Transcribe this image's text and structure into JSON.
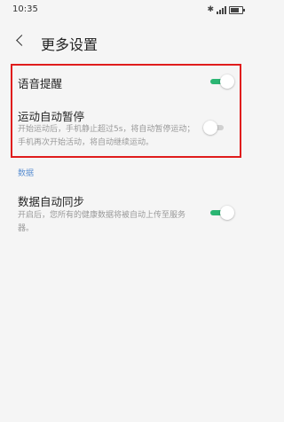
{
  "status_bar": {
    "time": "10:35",
    "bluetooth_symbol": "✱",
    "battery_icon": "battery-icon",
    "signal_icon": "signal-icon"
  },
  "header": {
    "title": "更多设置",
    "back_icon": "back-arrow-icon"
  },
  "settings": {
    "voice_reminder": {
      "label": "语音提醒",
      "enabled": true
    },
    "auto_pause": {
      "label": "运动自动暂停",
      "description_line1": "开始运动后，手机静止超过5s，将自动暂停运动；",
      "description_line2": "手机再次开始活动，将自动继续运动。",
      "enabled": false
    },
    "data_section": {
      "header": "数据"
    },
    "auto_sync": {
      "label": "数据自动同步",
      "description_line1": "开启后，您所有的健康数据将被自动上传至服务",
      "description_line2": "器。",
      "enabled": true
    }
  },
  "colors": {
    "accent_green": "#2bb673",
    "highlight_red": "#e01c1c",
    "section_blue": "#5b8fd1"
  }
}
